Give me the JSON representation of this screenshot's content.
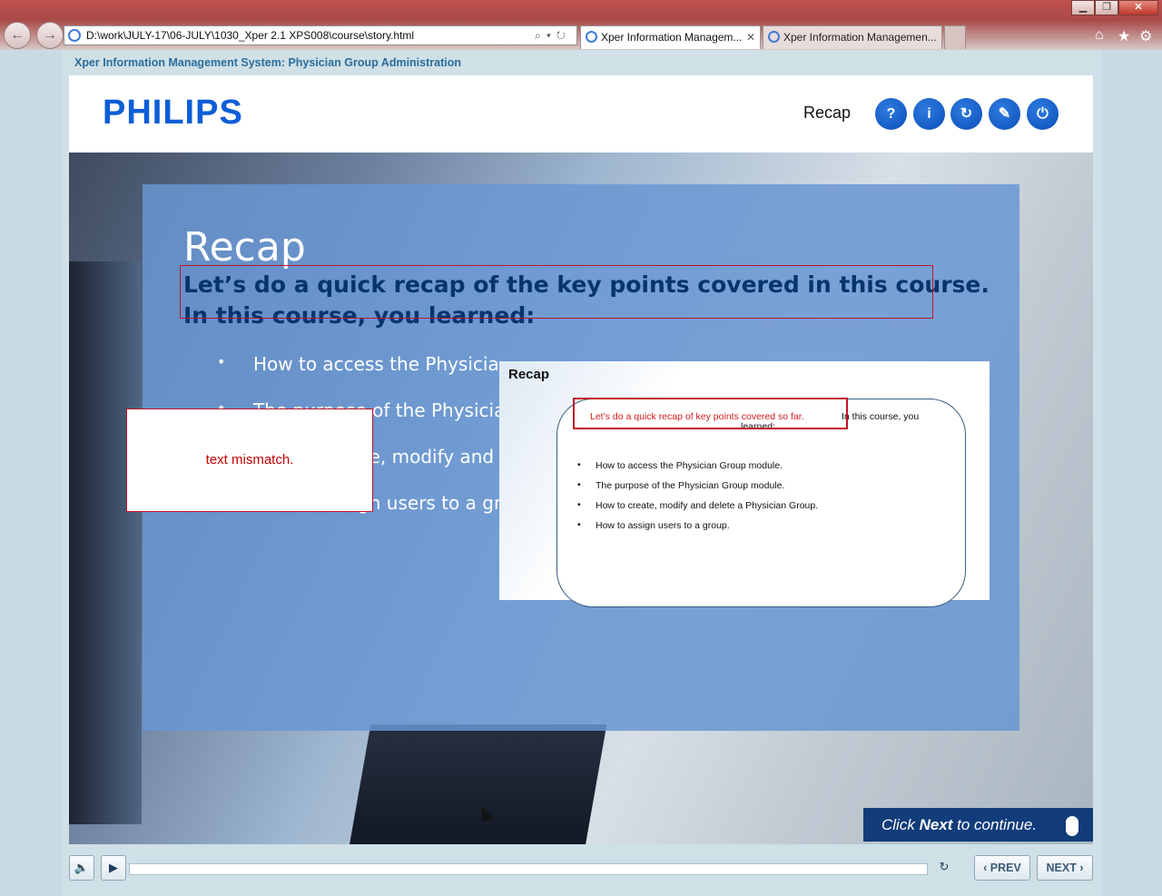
{
  "browser": {
    "address": "D:\\work\\JULY-17\\06-JULY\\1030_Xper 2.1 XPS008\\course\\story.html",
    "tabs": [
      {
        "label": "Xper Information Managem...",
        "close": "✕"
      },
      {
        "label": "Xper Information Managemen..."
      }
    ],
    "window_buttons": {
      "minimize": "▁",
      "restore": "❐",
      "close": "✕"
    }
  },
  "course": {
    "title": "Xper Information Management System: Physician Group Administration",
    "logo": "PHILIPS",
    "section_label": "Recap",
    "header_buttons": [
      {
        "name": "help",
        "glyph": "?"
      },
      {
        "name": "info",
        "glyph": "i"
      },
      {
        "name": "replay",
        "glyph": "↻"
      },
      {
        "name": "glossary",
        "glyph": "✎"
      },
      {
        "name": "exit",
        "glyph": "⏻"
      }
    ]
  },
  "slide": {
    "title": "Recap",
    "intro_line1": "Let’s do a quick recap of the key points covered in this course.",
    "intro_line2": "In this course, you learned:",
    "bullets": [
      "How to access the Physician Group module.",
      "The purpose of the Physician Group module.",
      "How to create, modify and delete a Physician Group.",
      "How to assign users to a group."
    ],
    "bullets_visible": [
      "How to access the Physicia",
      "The purpose of the Physicia",
      "How to create, modify and d",
      "How to assign users to a gro"
    ]
  },
  "reference": {
    "title": "Recap",
    "intro_red": "Let’s do a quick recap of key points covered so far.",
    "intro_black": "In this course, you",
    "intro_black2": "learned:",
    "bullets": [
      "How to access the Physician Group module.",
      "The purpose of the Physician Group module.",
      "How to create, modify and delete a Physician Group.",
      "How to assign users to a group."
    ]
  },
  "review_note": {
    "text": "text mismatch."
  },
  "continue": {
    "prefix": "Click ",
    "bold": "Next",
    "suffix": " to continue."
  },
  "player": {
    "prev_label": "PREV",
    "next_label": "NEXT",
    "progress": 0.0
  }
}
